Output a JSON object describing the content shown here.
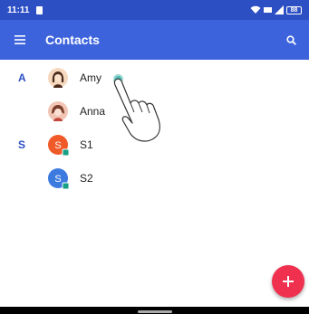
{
  "status_bar": {
    "time": "11:11",
    "battery": "88"
  },
  "app_bar": {
    "title": "Contacts",
    "menu_icon": "hamburger-menu-icon",
    "search_icon": "search-icon"
  },
  "contacts": {
    "sections": [
      {
        "letter": "A",
        "items": [
          {
            "name": "Amy",
            "avatar": "girl-avatar"
          },
          {
            "name": "Anna",
            "avatar": "girl-avatar"
          }
        ]
      },
      {
        "letter": "S",
        "items": [
          {
            "name": "S1",
            "avatar": "letter-avatar",
            "initial": "S",
            "color": "#f05a28"
          },
          {
            "name": "S2",
            "avatar": "letter-avatar",
            "initial": "S",
            "color": "#3d7ae0"
          }
        ]
      }
    ]
  },
  "fab": {
    "icon": "plus-icon",
    "color": "#f0304f"
  },
  "colors": {
    "status_bar": "#2d4fc4",
    "app_bar": "#3d63dc",
    "section_letter": "#2d4fc4"
  }
}
